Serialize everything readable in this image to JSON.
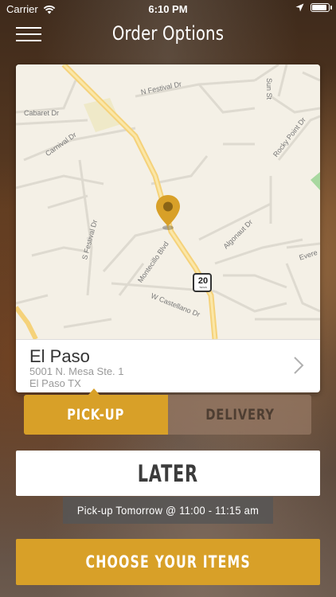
{
  "status_bar": {
    "carrier": "Carrier",
    "time": "6:10 PM"
  },
  "header": {
    "title": "Order Options"
  },
  "map": {
    "streets": [
      "N Festival Dr",
      "Cabaret Dr",
      "Carnival Dr",
      "Rocky Point Dr",
      "S Festival Dr",
      "Montecillo Blvd",
      "Algonaut Dr",
      "W Castellano Dr",
      "Evere",
      "Sun St"
    ],
    "route_sign": "20",
    "route_sign_sub": "TEXAS"
  },
  "location": {
    "name": "El Paso",
    "address_line1": "5001 N. Mesa Ste. 1",
    "address_line2": "El Paso TX"
  },
  "tabs": {
    "pickup_label": "PICK-UP",
    "delivery_label": "DELIVERY",
    "selected": "pickup"
  },
  "later": {
    "label": "LATER"
  },
  "pickup_note": {
    "text": "Pick-up Tomorrow @ 11:00 - 11:15 am"
  },
  "cta": {
    "label": "CHOOSE YOUR ITEMS"
  },
  "colors": {
    "accent": "#d8a028",
    "pin": "#d8a028"
  },
  "icons": [
    "wifi-icon",
    "location-arrow-icon",
    "battery-icon",
    "menu-icon",
    "map-pin-icon",
    "chevron-right-icon"
  ]
}
